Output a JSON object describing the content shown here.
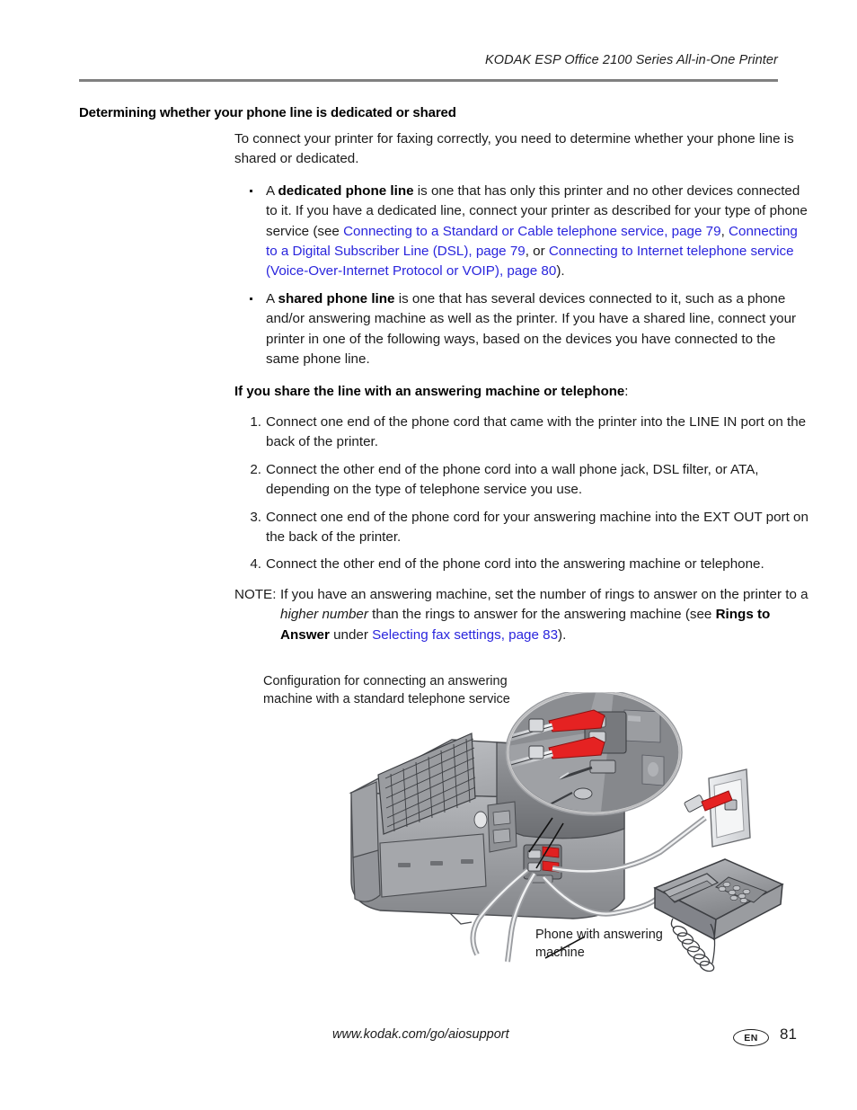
{
  "header": {
    "title": "KODAK ESP Office 2100 Series All-in-One Printer"
  },
  "section": {
    "heading": "Determining whether your phone line is dedicated or shared",
    "intro": "To connect your printer for faxing correctly, you need to determine whether your phone line is shared or dedicated."
  },
  "bullets": [
    {
      "lead": "A ",
      "bold": "dedicated phone line",
      "text_1": " is one that has only this printer and no other devices connected to it. If you have a dedicated line, connect your printer as described for your type of phone service (see ",
      "link_1": "Connecting to a Standard or Cable telephone service, page 79",
      "text_2": ", ",
      "link_2": "Connecting to a Digital Subscriber Line (DSL), page 79",
      "text_3": ", or ",
      "link_3": "Connecting to Internet telephone service (Voice-Over-Internet Protocol or VOIP), page 80",
      "text_4": ")."
    },
    {
      "lead": "A ",
      "bold": "shared phone line",
      "text_1": " is one that has several devices connected to it, such as a phone and/or answering machine as well as the printer. If you have a shared line, connect your printer in one of the following ways, based on the devices you have connected to the same phone line."
    }
  ],
  "subheading": {
    "text": "If you share the line with an answering machine or telephone",
    "colon": ":"
  },
  "steps": [
    {
      "num": "1.",
      "text": "Connect one end of the phone cord that came with the printer into the LINE IN port on the back of the printer."
    },
    {
      "num": "2.",
      "text": "Connect the other end of the phone cord into a wall phone jack, DSL filter, or ATA, depending on the type of telephone service you use."
    },
    {
      "num": "3.",
      "text": "Connect one end of the phone cord for your answering machine into the EXT OUT port on the back of the printer."
    },
    {
      "num": "4.",
      "text": "Connect the other end of the phone cord into the answering machine or telephone."
    }
  ],
  "note": {
    "label": "NOTE:",
    "text_1": "If you have an answering machine, set the number of rings to answer on the printer to a ",
    "italic_1": "higher number",
    "text_2": " than the rings to answer for the answering machine (see ",
    "bold_1": "Rings to Answer",
    "text_3": " under ",
    "link_1": "Selecting fax settings, page 83",
    "text_4": ")."
  },
  "figure": {
    "caption": "Configuration for connecting an answering machine with a standard telephone service",
    "phone_label": "Phone with answering machine",
    "colors": {
      "plug_red": "#e02020",
      "body_gray": "#8d8f93",
      "body_dark": "#6e7074",
      "body_light": "#b9bbbf",
      "outline": "#3c3e42"
    }
  },
  "footer": {
    "url": "www.kodak.com/go/aiosupport",
    "language": "EN",
    "page_number": "81"
  }
}
